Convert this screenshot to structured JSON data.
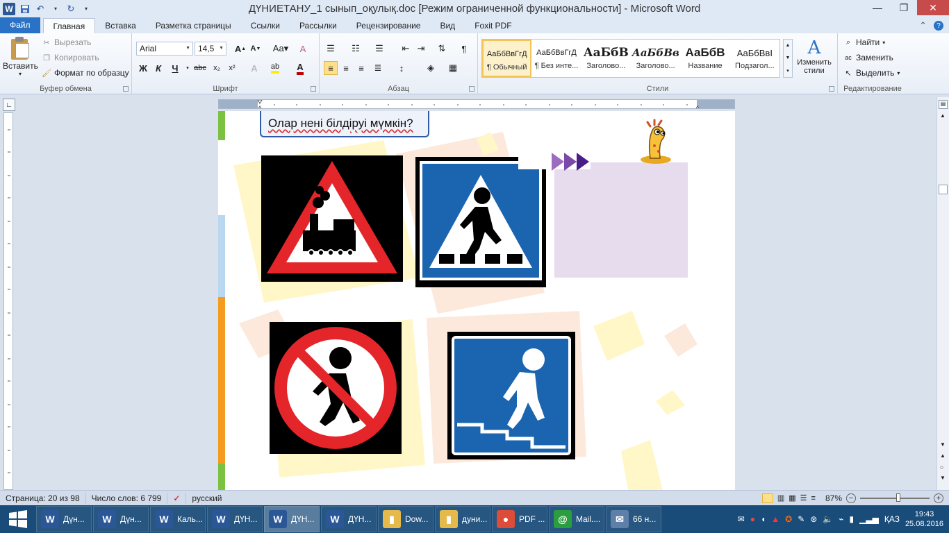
{
  "window": {
    "title": "ДҮНИЕТАНУ_1 сынып_оқулық.doc [Режим ограниченной функциональности] - Microsoft Word"
  },
  "qat": {
    "app_icon": "word-icon",
    "save": "save-icon",
    "undo": "undo-icon",
    "redo": "redo-icon",
    "customize": "customize-icon"
  },
  "tabs": {
    "file": "Файл",
    "items": [
      "Главная",
      "Вставка",
      "Разметка страницы",
      "Ссылки",
      "Рассылки",
      "Рецензирование",
      "Вид",
      "Foxit PDF"
    ],
    "active_index": 0
  },
  "clipboard": {
    "paste": "Вставить",
    "cut": "Вырезать",
    "copy": "Копировать",
    "format_painter": "Формат по образцу",
    "label": "Буфер обмена"
  },
  "font": {
    "name": "Arial",
    "size": "14,5",
    "bold": "Ж",
    "italic": "К",
    "underline": "Ч",
    "strike": "abc",
    "label": "Шрифт"
  },
  "paragraph": {
    "label": "Абзац"
  },
  "styles": {
    "label": "Стили",
    "items": [
      {
        "sample": "АаБбВвГгД",
        "name": "¶ Обычный"
      },
      {
        "sample": "АаБбВвГгД",
        "name": "¶ Без инте..."
      },
      {
        "sample": "АаБбВ",
        "name": "Заголово..."
      },
      {
        "sample": "АаБбВв",
        "name": "Заголово..."
      },
      {
        "sample": "АаБбВ",
        "name": "Название"
      },
      {
        "sample": "АаБбВвІ",
        "name": "Подзагол..."
      }
    ],
    "change": "Изменить стили"
  },
  "editing": {
    "find": "Найти",
    "replace": "Заменить",
    "select": "Выделить",
    "label": "Редактирование"
  },
  "document": {
    "heading": "Олар нені білдіруі мүмкін?",
    "signs": [
      "railway-crossing-sign",
      "pedestrian-crossing-sign",
      "no-pedestrians-sign",
      "underground-crossing-sign"
    ],
    "mascot": "giraffe-mascot"
  },
  "status": {
    "page": "Страница: 20 из 98",
    "words": "Число слов: 6 799",
    "language": "русский",
    "zoom": "87%"
  },
  "taskbar": {
    "items": [
      {
        "label": "Дүн...",
        "icon": "W",
        "color": "#2b5797"
      },
      {
        "label": "Дүн...",
        "icon": "W",
        "color": "#2b5797"
      },
      {
        "label": "Каль...",
        "icon": "W",
        "color": "#2b5797"
      },
      {
        "label": "ДҮН...",
        "icon": "W",
        "color": "#2b5797"
      },
      {
        "label": "ДҮН...",
        "icon": "W",
        "color": "#2b5797"
      },
      {
        "label": "ДҮН...",
        "icon": "W",
        "color": "#2b5797"
      },
      {
        "label": "Dow...",
        "icon": "▮",
        "color": "#e5b94a"
      },
      {
        "label": "дуни...",
        "icon": "▮",
        "color": "#e5b94a"
      },
      {
        "label": "PDF ...",
        "icon": "●",
        "color": "#dd4b39"
      },
      {
        "label": "Mail....",
        "icon": "@",
        "color": "#2a9d3f"
      },
      {
        "label": "66 н...",
        "icon": "✉",
        "color": "#5d7fa8"
      }
    ],
    "lang": "ҚАЗ",
    "time": "19:43",
    "date": "25.08.2016"
  }
}
